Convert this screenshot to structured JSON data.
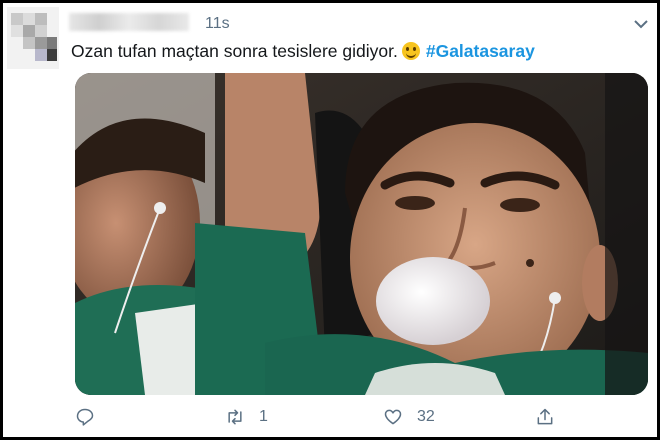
{
  "tweet": {
    "timestamp": "11s",
    "text": "Ozan tufan maçtan sonra tesislere gidiyor.",
    "hashtag": "#Galatasaray"
  },
  "actions": {
    "reply": {
      "icon": "reply-icon",
      "count": ""
    },
    "retweet": {
      "icon": "retweet-icon",
      "count": "1"
    },
    "like": {
      "icon": "heart-icon",
      "count": "32"
    },
    "share": {
      "icon": "share-icon",
      "count": ""
    }
  },
  "colors": {
    "text": "#14171a",
    "secondary": "#5b7083",
    "hashtag": "#1b95e0"
  }
}
